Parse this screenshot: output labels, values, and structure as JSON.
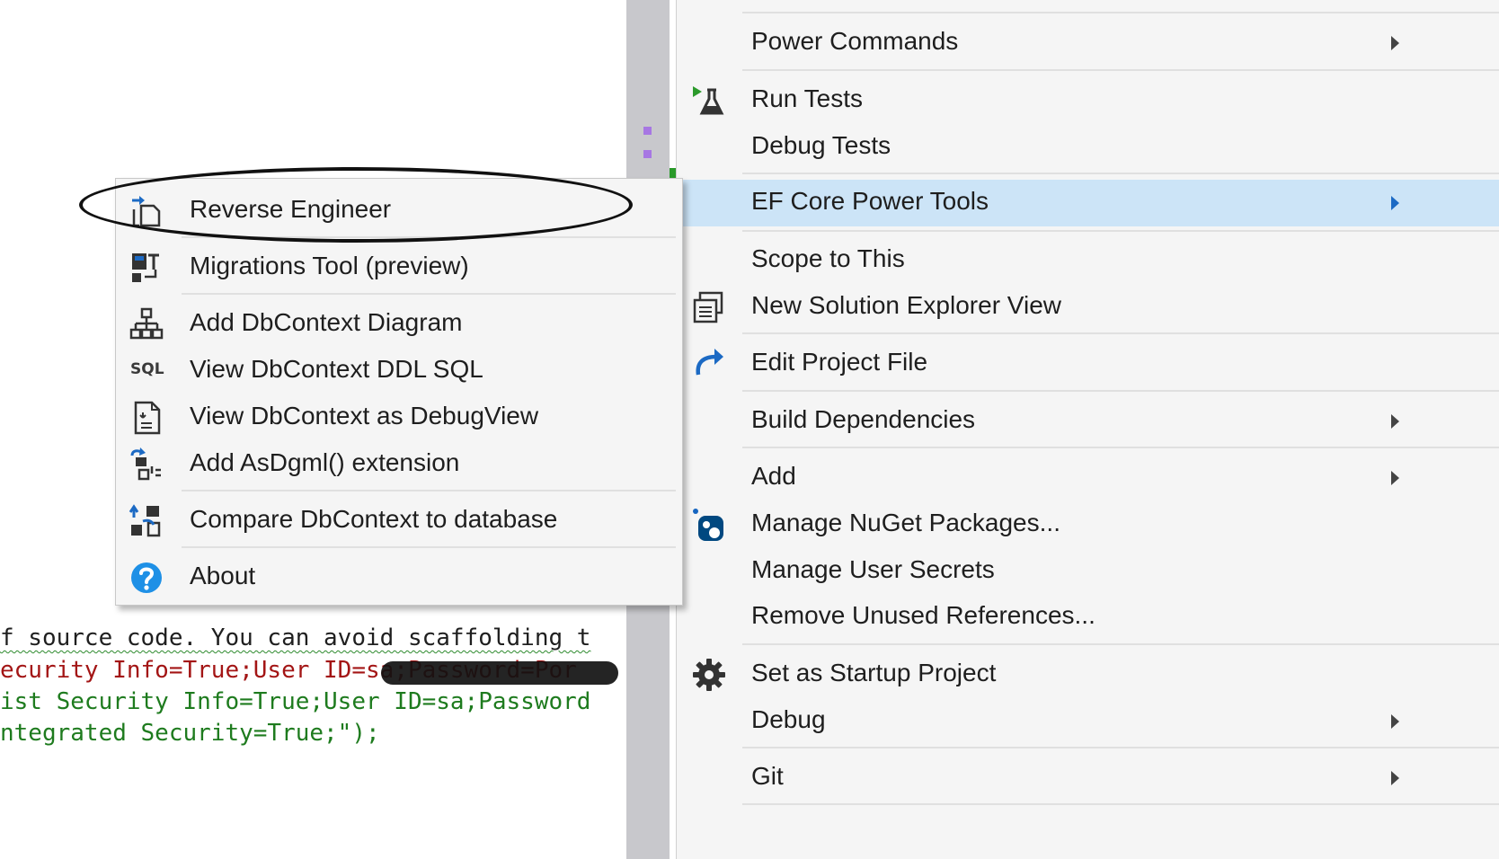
{
  "editor": {
    "lines": [
      {
        "text": "f source code. You can avoid scaffolding t",
        "style": "dark"
      },
      {
        "text": "ecurity Info=True;User ID=sa;Password=Por",
        "style": "red"
      },
      {
        "text": "ist Security Info=True;User ID=sa;Password",
        "style": "green"
      },
      {
        "text": "ntegrated Security=True;\");",
        "style": "green"
      }
    ]
  },
  "context_menu": {
    "items": [
      {
        "label": "Power Commands",
        "has_submenu": true,
        "icon": ""
      },
      {
        "label": "Run Tests",
        "has_submenu": false,
        "icon": "run-tests-icon"
      },
      {
        "label": "Debug Tests",
        "has_submenu": false,
        "icon": ""
      },
      {
        "label": "EF Core Power Tools",
        "has_submenu": true,
        "icon": "",
        "selected": true
      },
      {
        "label": "Scope to This",
        "has_submenu": false,
        "icon": ""
      },
      {
        "label": "New Solution Explorer View",
        "has_submenu": false,
        "icon": "new-view-icon"
      },
      {
        "label": "Edit Project File",
        "has_submenu": false,
        "icon": "edit-arrow-icon"
      },
      {
        "label": "Build Dependencies",
        "has_submenu": true,
        "icon": ""
      },
      {
        "label": "Add",
        "has_submenu": true,
        "icon": ""
      },
      {
        "label": "Manage NuGet Packages...",
        "has_submenu": false,
        "icon": "nuget-icon"
      },
      {
        "label": "Manage User Secrets",
        "has_submenu": false,
        "icon": ""
      },
      {
        "label": "Remove Unused References...",
        "has_submenu": false,
        "icon": ""
      },
      {
        "label": "Set as Startup Project",
        "has_submenu": false,
        "icon": "gear-icon"
      },
      {
        "label": "Debug",
        "has_submenu": true,
        "icon": ""
      },
      {
        "label": "Git",
        "has_submenu": true,
        "icon": ""
      }
    ]
  },
  "submenu": {
    "items": [
      {
        "label": "Reverse Engineer",
        "icon": "reverse-engineer-icon"
      },
      {
        "label": "Migrations Tool (preview)",
        "icon": "migrations-icon"
      },
      {
        "label": "Add DbContext Diagram",
        "icon": "diagram-icon"
      },
      {
        "label": "View DbContext DDL SQL",
        "icon": "sql-icon",
        "icon_text": "SQL"
      },
      {
        "label": "View DbContext as DebugView",
        "icon": "debugview-icon"
      },
      {
        "label": "Add AsDgml() extension",
        "icon": "dgml-icon"
      },
      {
        "label": "Compare DbContext to database",
        "icon": "compare-icon"
      },
      {
        "label": "About",
        "icon": "help-icon"
      }
    ]
  },
  "colors": {
    "menu_bg": "#f5f5f5",
    "selected_bg": "#cce4f7",
    "code_red": "#a31515",
    "code_green": "#1e7b1e",
    "accent_blue": "#1c6ac4"
  }
}
